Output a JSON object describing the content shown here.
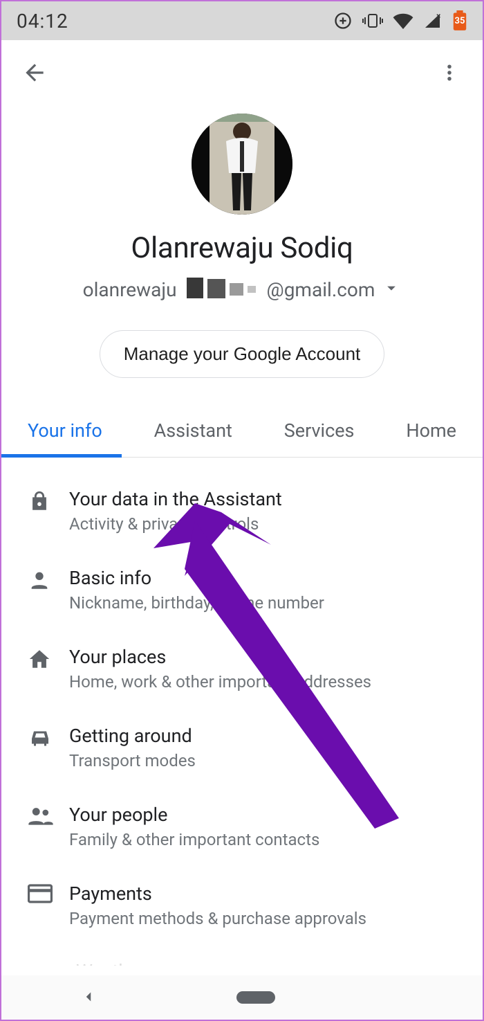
{
  "status": {
    "time": "04:12",
    "battery_badge": "35"
  },
  "profile": {
    "display_name": "Olanrewaju Sodiq",
    "email_prefix": "olanrewaju",
    "email_suffix": "@gmail.com",
    "manage_label": "Manage your Google Account"
  },
  "tabs": [
    {
      "label": "Your info",
      "active": true
    },
    {
      "label": "Assistant",
      "active": false
    },
    {
      "label": "Services",
      "active": false
    },
    {
      "label": "Home",
      "active": false
    }
  ],
  "items": [
    {
      "icon": "lock-icon",
      "title": "Your data in the Assistant",
      "sub": "Activity & privacy controls"
    },
    {
      "icon": "person-icon",
      "title": "Basic info",
      "sub": "Nickname, birthday, phone number"
    },
    {
      "icon": "home-icon",
      "title": "Your places",
      "sub": "Home, work & other important addresses"
    },
    {
      "icon": "car-icon",
      "title": "Getting around",
      "sub": "Transport modes"
    },
    {
      "icon": "people-icon",
      "title": "Your people",
      "sub": "Family & other important contacts"
    },
    {
      "icon": "card-icon",
      "title": "Payments",
      "sub": "Payment methods & purchase approvals"
    }
  ],
  "annotation": {
    "color": "#6a0dad"
  }
}
